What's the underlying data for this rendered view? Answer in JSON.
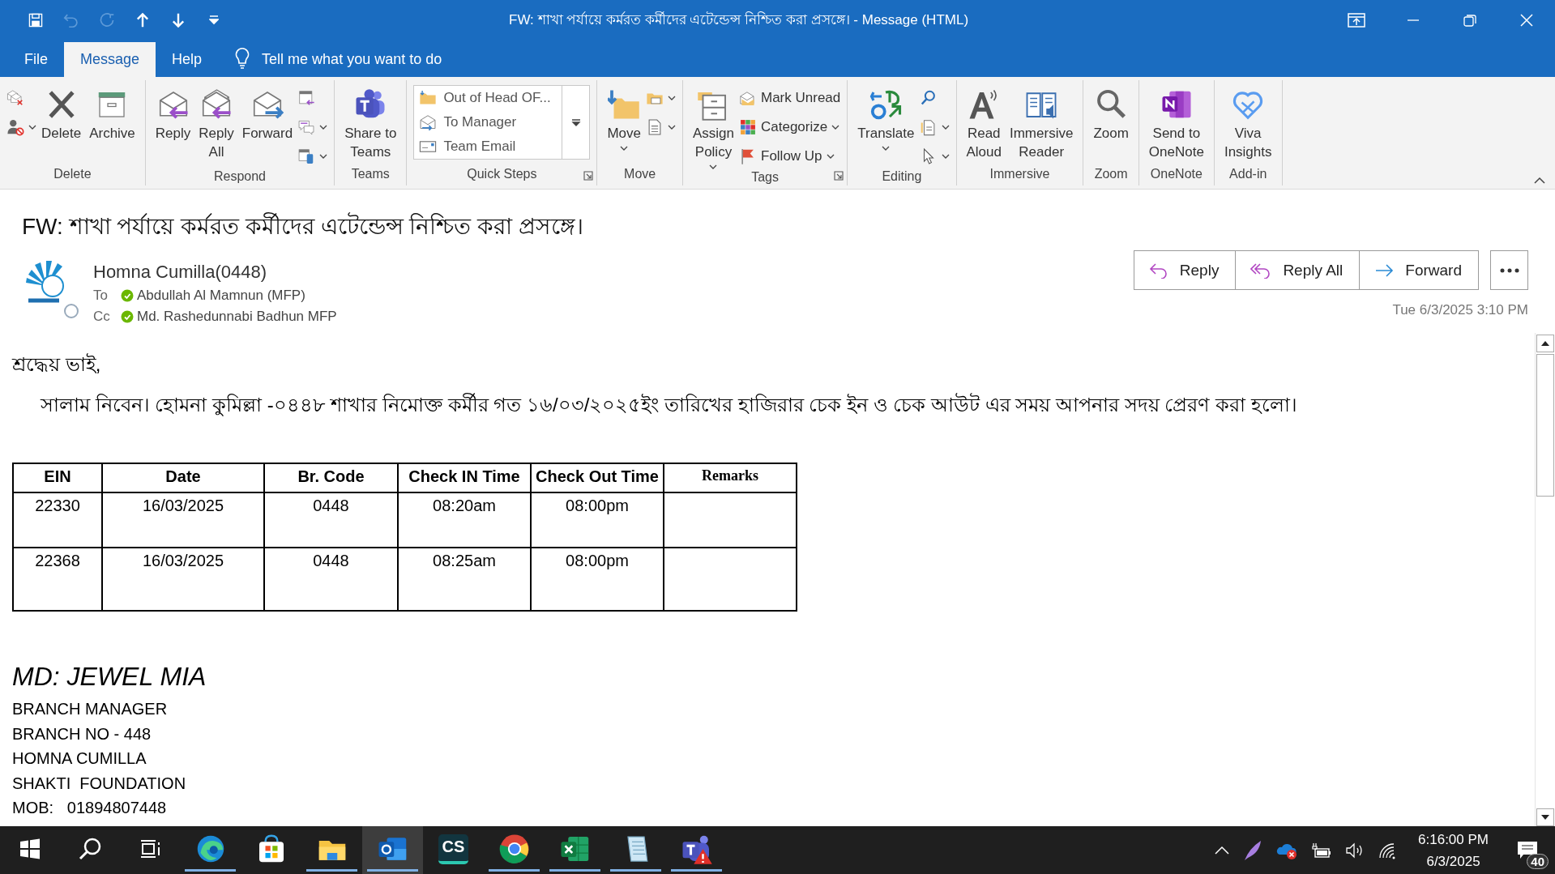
{
  "window": {
    "title": "FW: শাখা পর্যায়ে কর্মরত কর্মীদের এটেন্ডেন্স নিশ্চিত করা প্রসঙ্গে।  -  Message (HTML)",
    "quick_access": [
      {
        "disabled": false
      },
      {
        "disabled": true
      },
      {
        "disabled": true
      },
      {
        "disabled": false
      },
      {
        "disabled": false
      },
      {
        "disabled": false
      }
    ]
  },
  "menu_tabs": [
    {
      "label": "File",
      "selected": false
    },
    {
      "label": "Message",
      "selected": true
    },
    {
      "label": "Help",
      "selected": false
    }
  ],
  "tell_me": "Tell me what you want to do",
  "ribbon": {
    "groups": [
      {
        "label": "Delete",
        "items": [
          {
            "kind": "stack",
            "items": [
              {
                "dropdown": false
              },
              {
                "dropdown": true
              }
            ]
          },
          {
            "kind": "large",
            "label_lines": [
              "Delete"
            ],
            "dropdown": false
          },
          {
            "kind": "large",
            "label_lines": [
              "Archive"
            ],
            "dropdown": false
          }
        ]
      },
      {
        "label": "Respond",
        "items": [
          {
            "kind": "large",
            "label_lines": [
              "Reply"
            ],
            "dropdown": false
          },
          {
            "kind": "large",
            "label_lines": [
              "Reply",
              "All"
            ],
            "dropdown": false
          },
          {
            "kind": "large",
            "label_lines": [
              "Forward"
            ],
            "dropdown": false
          },
          {
            "kind": "stack",
            "items": [
              {
                "dropdown": false
              },
              {
                "dropdown": true
              },
              {
                "dropdown": true
              }
            ]
          }
        ]
      },
      {
        "label": "Teams",
        "items": [
          {
            "kind": "large",
            "label_lines": [
              "Share to",
              "Teams"
            ],
            "dropdown": false
          }
        ]
      },
      {
        "label": "Quick Steps",
        "launcher": true,
        "items": [
          {
            "kind": "gallery",
            "items": [
              {
                "label": "Out of Head OF..."
              },
              {
                "label": "To Manager"
              },
              {
                "label": "Team Email"
              }
            ]
          }
        ]
      },
      {
        "label": "Move",
        "items": [
          {
            "kind": "large",
            "label_lines": [
              "Move"
            ],
            "dropdown": true
          },
          {
            "kind": "stack",
            "items": [
              {
                "dropdown": true
              },
              {
                "dropdown": true
              }
            ]
          }
        ]
      },
      {
        "label": "Tags",
        "launcher": true,
        "items": [
          {
            "kind": "large",
            "label_lines": [
              "Assign",
              "Policy"
            ],
            "dropdown": true
          },
          {
            "kind": "stack",
            "items": [
              {
                "label": "Mark Unread",
                "dropdown": false
              },
              {
                "label": "Categorize",
                "dropdown": true
              },
              {
                "label": "Follow Up",
                "dropdown": true
              }
            ]
          }
        ]
      },
      {
        "label": "Editing",
        "items": [
          {
            "kind": "large",
            "label_lines": [
              "Translate"
            ],
            "dropdown": true
          },
          {
            "kind": "stack",
            "items": [
              {
                "dropdown": false
              },
              {
                "dropdown": true
              },
              {
                "dropdown": true
              }
            ]
          }
        ]
      },
      {
        "label": "Immersive",
        "items": [
          {
            "kind": "large",
            "label_lines": [
              "Read",
              "Aloud"
            ],
            "dropdown": false
          },
          {
            "kind": "large",
            "label_lines": [
              "Immersive",
              "Reader"
            ],
            "dropdown": false
          }
        ]
      },
      {
        "label": "Zoom",
        "items": [
          {
            "kind": "large",
            "label_lines": [
              "Zoom"
            ],
            "dropdown": false
          }
        ]
      },
      {
        "label": "OneNote",
        "items": [
          {
            "kind": "large",
            "label_lines": [
              "Send to",
              "OneNote"
            ],
            "dropdown": false
          }
        ]
      },
      {
        "label": "Add-in",
        "items": [
          {
            "kind": "large",
            "label_lines": [
              "Viva",
              "Insights"
            ],
            "dropdown": false
          }
        ]
      }
    ]
  },
  "message": {
    "subject": "FW: শাখা পর্যায়ে কর্মরত কর্মীদের এটেন্ডেন্স নিশ্চিত করা প্রসঙ্গে।",
    "sender": {
      "name": "Homna Cumilla(0448)",
      "online": false
    },
    "recipients": [
      {
        "label": "To",
        "name": "Abdullah Al Mamnun (MFP)",
        "online": true
      },
      {
        "label": "Cc",
        "name": "Md. Rashedunnabi Badhun MFP",
        "online": true
      }
    ],
    "actions": [
      {
        "label": "Reply"
      },
      {
        "label": "Reply All"
      },
      {
        "label": "Forward"
      }
    ],
    "date": "Tue 6/3/2025 3:10 PM"
  },
  "body": {
    "greeting": "শ্রদ্ধেয় ভাই,",
    "paragraph": "সালাম নিবেন। হোমনা কুমিল্লা -০৪৪৮ শাখার নিমোক্ত কর্মীর গত ১৬/০৩/২০২৫ইং তারিখের হাজিরার চেক ইন ও চেক আউট এর সময় আপনার সদয় প্রেরণ করা হলো।",
    "table": {
      "columns": [
        "EIN",
        "Date",
        "Br. Code",
        "Check IN Time",
        "Check Out Time",
        "Remarks"
      ],
      "rows": [
        [
          "22330",
          "16/03/2025",
          "0448",
          "08:20am",
          "08:00pm",
          ""
        ],
        [
          "22368",
          "16/03/2025",
          "0448",
          "08:25am",
          "08:00pm",
          ""
        ]
      ]
    },
    "signature_name": "MD: JEWEL MIA",
    "signature_lines": [
      "BRANCH MANAGER",
      "BRANCH NO - 448",
      "HOMNA CUMILLA",
      "SHAKTI  FOUNDATION",
      "MOB:   01894807448"
    ]
  },
  "taskbar": {
    "apps": [
      {
        "running": true,
        "selected": false
      },
      {
        "running": false,
        "selected": false
      },
      {
        "running": true,
        "selected": false
      },
      {
        "running": true,
        "selected": true
      },
      {
        "running": false,
        "selected": false,
        "label": "CS"
      },
      {
        "running": true,
        "selected": false
      },
      {
        "running": true,
        "selected": false
      },
      {
        "running": true,
        "selected": false
      },
      {
        "running": true,
        "selected": false
      }
    ],
    "time": "6:16:00 PM",
    "date": "6/3/2025",
    "notifications": "40"
  }
}
